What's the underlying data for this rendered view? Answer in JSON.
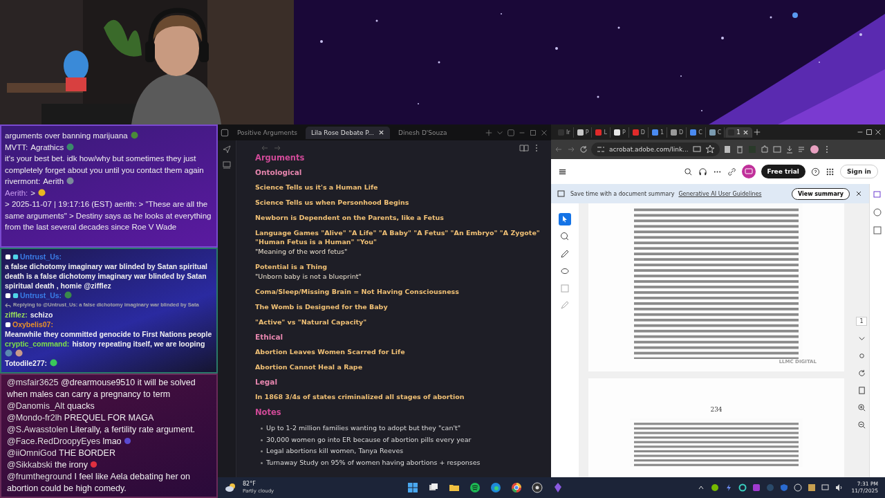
{
  "chat_top": [
    {
      "parts": [
        {
          "kind": "text",
          "text": "arguments over banning marijuana"
        },
        {
          "kind": "emote",
          "color": "#4a8a3a"
        }
      ]
    },
    {
      "parts": [
        {
          "kind": "user",
          "text": "MVTT:",
          "color": "#f2f2f2"
        },
        {
          "kind": "text",
          "text": "Agrathics"
        },
        {
          "kind": "emote",
          "color": "#3a8a6a"
        },
        {
          "kind": "text",
          "text": "it's your best bet. idk how/why but sometimes they just completely forget about you until you contact them again"
        }
      ]
    },
    {
      "parts": [
        {
          "kind": "user",
          "text": "rivermont:",
          "color": "#f2f2f2"
        },
        {
          "kind": "text",
          "text": "Aerith"
        },
        {
          "kind": "emote",
          "color": "#7a8a9a"
        }
      ]
    },
    {
      "parts": [
        {
          "kind": "user",
          "text": "Aerith:",
          "color": "#c99cf0"
        },
        {
          "kind": "text",
          "text": ">"
        },
        {
          "kind": "emote",
          "color": "#e8b820"
        },
        {
          "kind": "text",
          "text": "> 2025-11-07 | 19:17:16 (EST) aerith: > \"These are all the same arguments\" > Destiny says as he looks at everything from the last several decades since Roe V Wade"
        }
      ]
    }
  ],
  "chat_mid": [
    {
      "parts": [
        {
          "kind": "badge",
          "color": "#ffffff"
        },
        {
          "kind": "badge",
          "color": "#4fd3e8"
        },
        {
          "kind": "user",
          "text": "Untrust_Us:",
          "color": "#3a7de8"
        },
        {
          "kind": "text",
          "text": "a false dichotomy imaginary war blinded by Satan spiritual death is a false dichotomy imaginary war blinded by Satan spiritual death , homie @zifflez"
        }
      ]
    },
    {
      "parts": [
        {
          "kind": "badge",
          "color": "#ffffff"
        },
        {
          "kind": "badge",
          "color": "#4fd3e8"
        },
        {
          "kind": "user",
          "text": "Untrust_Us:",
          "color": "#3a7de8"
        },
        {
          "kind": "emote",
          "color": "#3a8a4a"
        }
      ]
    },
    {
      "parts": [
        {
          "kind": "reply",
          "text": "Replying to @Untrust_Us: a false dichotomy imaginary war blinded by Sata"
        }
      ]
    },
    {
      "parts": [
        {
          "kind": "user",
          "text": "zifflez:",
          "color": "#9be05a"
        },
        {
          "kind": "text",
          "text": "schizo"
        }
      ]
    },
    {
      "parts": [
        {
          "kind": "badge",
          "color": "#ffffff"
        },
        {
          "kind": "user",
          "text": "Oxybelis07:",
          "color": "#e8902a"
        },
        {
          "kind": "text",
          "text": "Meanwhile they committed genocide to First Nations people"
        }
      ]
    },
    {
      "parts": [
        {
          "kind": "user",
          "text": "cryptic_command:",
          "color": "#7ee04a"
        },
        {
          "kind": "text",
          "text": "history repeating itself, we are looping"
        },
        {
          "kind": "emote",
          "color": "#5a8ab0"
        },
        {
          "kind": "emote",
          "color": "#c89a8a"
        }
      ]
    },
    {
      "parts": [
        {
          "kind": "user",
          "text": "Totodile277:",
          "color": "#f2f2f2"
        },
        {
          "kind": "emote",
          "color": "#3ac85a"
        }
      ]
    }
  ],
  "chat_bottom": [
    {
      "user": "@msfair3625",
      "text": "@drearmouse9510 it will be solved when males can carry a pregnancy to term"
    },
    {
      "user": "@Danomis_Alt",
      "text": "quacks"
    },
    {
      "user": "@Mondo-fr2lh",
      "text": "PREQUEL FOR MAGA"
    },
    {
      "user": "@S.Awasstolen",
      "text": "Literally, a fertility rate argument."
    },
    {
      "user": "@Face.RedDroopyEyes",
      "text": "lmao",
      "color": "#5a4ad0"
    },
    {
      "user": "@iiOmniGod",
      "text": "THE BORDER"
    },
    {
      "user": "@Sikkabski",
      "text": "the irony",
      "color": "#e03040"
    },
    {
      "user": "@frumtheground",
      "text": "I feel like Aela debating her on abortion could be high comedy."
    }
  ],
  "notes": {
    "tabs": [
      {
        "label": "Positive Arguments",
        "selected": false
      },
      {
        "label": "Lila Rose Debate P...",
        "selected": true
      },
      {
        "label": "Dinesh D'Souza",
        "selected": false
      }
    ],
    "content": [
      {
        "kind": "h1",
        "text": "Arguments"
      },
      {
        "kind": "h2",
        "text": "Ontological"
      },
      {
        "kind": "item",
        "text": "Science Tells us it's a Human Life"
      },
      {
        "kind": "item",
        "text": "Science Tells us when Personhood Begins"
      },
      {
        "kind": "item",
        "text": "Newborn is Dependent on the Parents, like a Fetus"
      },
      {
        "kind": "item",
        "text": "Language Games \"Alive\" \"A Life\" \"A Baby\" \"A Fetus\" \"An Embryo\" \"A Zygote\" \"Human Fetus is a Human\" \"You\"",
        "note": "\"Meaning of the word fetus\""
      },
      {
        "kind": "item",
        "text": "Potential is a Thing",
        "note": "\"Unborn baby is not a blueprint\""
      },
      {
        "kind": "item",
        "text": "Coma/Sleep/Missing Brain = Not Having Consciousness"
      },
      {
        "kind": "item",
        "text": "The Womb is Designed for the Baby"
      },
      {
        "kind": "item",
        "text": "\"Active\" vs \"Natural Capacity\""
      },
      {
        "kind": "h2",
        "text": "Ethical"
      },
      {
        "kind": "item",
        "text": "Abortion Leaves Women Scarred for Life"
      },
      {
        "kind": "item",
        "text": "Abortion Cannot Heal a Rape"
      },
      {
        "kind": "h2",
        "text": "Legal"
      },
      {
        "kind": "item",
        "text": "In 1868 3/4s of states criminalized all stages of abortion"
      },
      {
        "kind": "h1",
        "text": "Notes"
      },
      {
        "kind": "bullet",
        "text": "Up to 1-2 million families wanting to adopt but they \"can't\""
      },
      {
        "kind": "bullet",
        "text": "30,000 women go into ER because of abortion pills every year"
      },
      {
        "kind": "bullet",
        "text": "Legal abortions kill women, Tanya Reeves"
      },
      {
        "kind": "bullet",
        "text": "Turnaway Study on 95% of women having abortions + responses"
      }
    ]
  },
  "browser": {
    "tabs": [
      {
        "label": "Ir",
        "selected": false,
        "color": "#333333"
      },
      {
        "label": "P",
        "selected": false,
        "color": "#c8c8c8"
      },
      {
        "label": "L",
        "selected": false,
        "color": "#e02a2a"
      },
      {
        "label": "P",
        "selected": false,
        "color": "#e8e8e8"
      },
      {
        "label": "D",
        "selected": false,
        "color": "#e02a2a"
      },
      {
        "label": "1",
        "selected": false,
        "color": "#4a8af0"
      },
      {
        "label": "D",
        "selected": false,
        "color": "#9a9a9a"
      },
      {
        "label": "C",
        "selected": false,
        "color": "#4a8af0"
      },
      {
        "label": "C",
        "selected": false,
        "color": "#7a9ab0"
      },
      {
        "label": "1",
        "selected": true,
        "color": "#2a2a2a"
      }
    ],
    "address": "acrobat.adobe.com/link...",
    "free_trial": "Free trial",
    "sign_in": "Sign in",
    "banner": {
      "text": "Save time with a document summary",
      "link": "Generative AI User Guidelines",
      "button": "View summary"
    },
    "page_indicator": "1",
    "page_number": "234",
    "scan_mark": "LLMC DIGITAL"
  },
  "taskbar": {
    "temperature": "82°F",
    "weather": "Partly cloudy",
    "time": "7:31 PM",
    "date": "11/7/2025"
  }
}
